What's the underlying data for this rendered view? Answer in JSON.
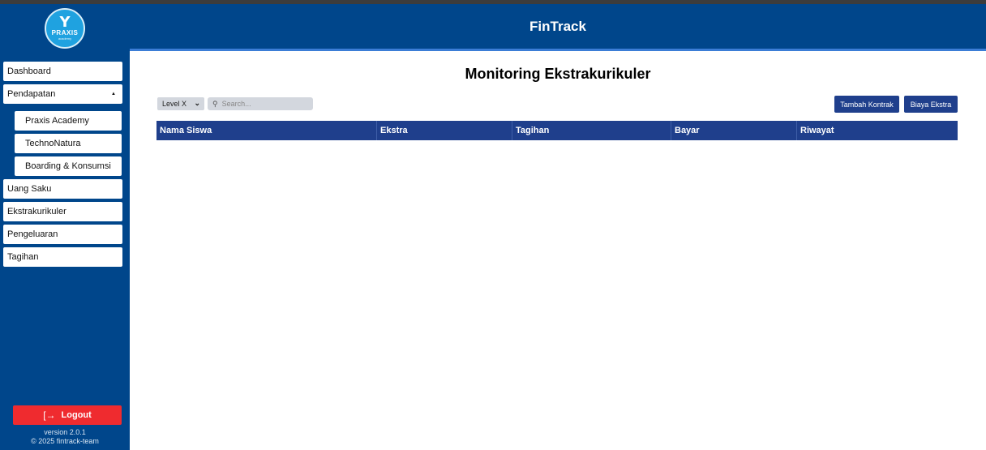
{
  "app": {
    "title": "FinTrack",
    "logo_text": "PRAXIS",
    "logo_subtext": "academy",
    "logo_mark": "Y"
  },
  "sidebar": {
    "items": [
      {
        "label": "Dashboard"
      },
      {
        "label": "Pendapatan",
        "expanded": true,
        "caret": "▲"
      },
      {
        "label": "Praxis Academy"
      },
      {
        "label": "TechnoNatura"
      },
      {
        "label": "Boarding & Konsumsi"
      },
      {
        "label": "Uang Saku"
      },
      {
        "label": "Ekstrakurikuler"
      },
      {
        "label": "Pengeluaran"
      },
      {
        "label": "Tagihan"
      }
    ],
    "logout_label": "Logout",
    "logout_icon": "[→",
    "version": "version 2.0.1",
    "copyright": "© 2025 fintrack-team"
  },
  "main": {
    "title": "Monitoring Ekstrakurikuler",
    "filter": {
      "selected": "Level X",
      "chevron": "⌄"
    },
    "search": {
      "placeholder": "Search...",
      "value": "",
      "icon": "⚲"
    },
    "buttons": {
      "tambah_kontrak": "Tambah Kontrak",
      "biaya_ekstra": "Biaya Ekstra"
    },
    "table": {
      "columns": [
        "Nama Siswa",
        "Ekstra",
        "Tagihan",
        "Bayar",
        "Riwayat"
      ],
      "rows": []
    }
  },
  "colors": {
    "primary": "#00468b",
    "table_header": "#1f3f8c",
    "logout": "#ef2b2f",
    "logo": "#1fa2e0"
  }
}
